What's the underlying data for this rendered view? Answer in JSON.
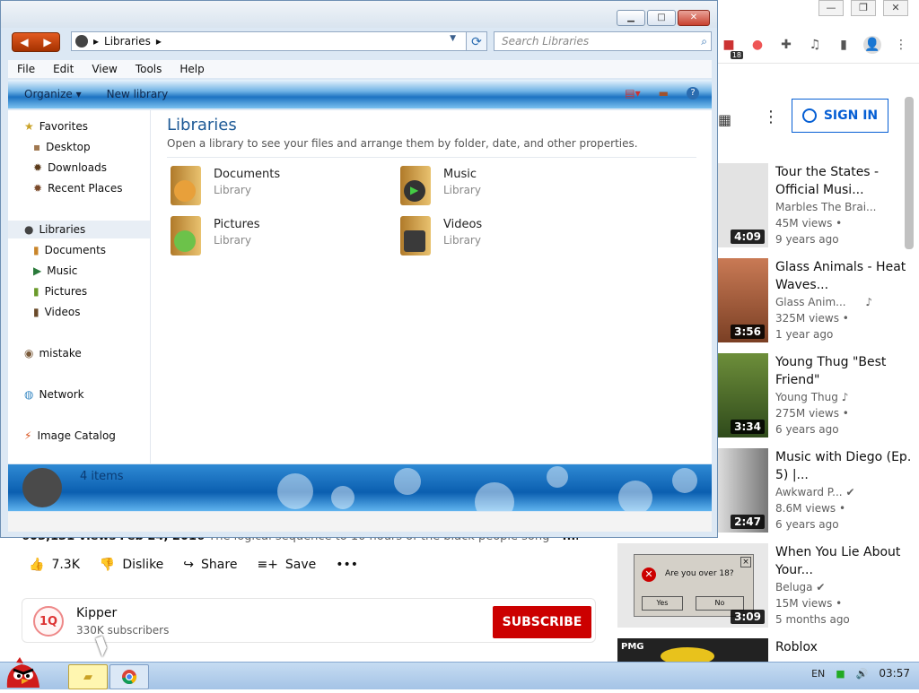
{
  "chrome": {
    "window_controls": [
      "—",
      "❐",
      "✕"
    ],
    "ext_badge": "18",
    "signin_label": "SIGN IN"
  },
  "recommendations": [
    {
      "title": "Tour the States - Official Musi...",
      "channel": "Marbles The Brai...",
      "views": "45M views •",
      "age": "9 years ago",
      "duration": "4:09",
      "thumb_color": "#d7d7d7"
    },
    {
      "title": "Glass Animals - Heat Waves...",
      "channel": "Glass Anim...",
      "views": "325M views •",
      "age": "1 year ago",
      "duration": "3:56",
      "thumb_color": "#a0522d",
      "music": "♪"
    },
    {
      "title": "Young Thug \"Best Friend\"",
      "channel": "Young Thug",
      "views": "275M views •",
      "age": "6 years ago",
      "duration": "3:34",
      "thumb_color": "#4b6b2f",
      "music": "♪"
    },
    {
      "title": "Music with Diego (Ep. 5) |...",
      "channel": "Awkward P...",
      "views": "8.6M views •",
      "age": "6 years ago",
      "duration": "2:47",
      "thumb_color": "#9a9a9a",
      "verified": "✔"
    },
    {
      "title": "When You Lie About Your...",
      "channel": "Beluga",
      "views": "15M views •",
      "age": "5 months ago",
      "duration": "3:09",
      "thumb_color": "#d4d0c8",
      "verified": "✔",
      "dialog": {
        "text": "Are you over 18?",
        "yes": "Yes",
        "no": "No"
      }
    },
    {
      "title": "Roblox",
      "thumb_label": "PMG"
    }
  ],
  "video": {
    "views": "603,131 views",
    "date": "Feb 24, 2016",
    "description": "The logical sequence to 10 hours of the black people song",
    "more": "...more",
    "likes": "7.3K",
    "dislike": "Dislike",
    "share": "Share",
    "save": "Save",
    "more_actions": "•••"
  },
  "channel": {
    "logo": "1Q",
    "name": "Kipper",
    "subscribers": "330K subscribers",
    "subscribe": "SUBSCRIBE"
  },
  "explorer": {
    "address": "Libraries",
    "search_placeholder": "Search Libraries",
    "menu": [
      "File",
      "Edit",
      "View",
      "Tools",
      "Help"
    ],
    "commands": [
      "Organize ▾",
      "New library"
    ],
    "nav": {
      "favorites_header": "Favorites",
      "favorites": [
        "Desktop",
        "Downloads",
        "Recent Places"
      ],
      "libraries_header": "Libraries",
      "libraries": [
        "Documents",
        "Music",
        "Pictures",
        "Videos"
      ],
      "other": [
        "mistake",
        "Network",
        "Image Catalog"
      ]
    },
    "title": "Libraries",
    "description": "Open a library to see your files and arrange them by folder, date, and other properties.",
    "libraries": [
      {
        "name": "Documents",
        "type": "Library"
      },
      {
        "name": "Music",
        "type": "Library"
      },
      {
        "name": "Pictures",
        "type": "Library"
      },
      {
        "name": "Videos",
        "type": "Library"
      }
    ],
    "item_count": "4 items"
  },
  "taskbar": {
    "lang": "EN",
    "time": "03:57"
  }
}
